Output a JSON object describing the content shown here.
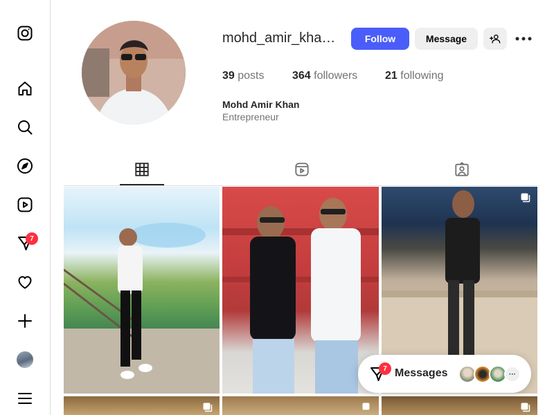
{
  "sidebar": {
    "items": [
      {
        "name": "instagram-logo-icon"
      },
      {
        "name": "home-icon"
      },
      {
        "name": "search-icon"
      },
      {
        "name": "explore-icon"
      },
      {
        "name": "reels-icon"
      },
      {
        "name": "messages-icon",
        "badge": "7"
      },
      {
        "name": "notifications-heart-icon"
      },
      {
        "name": "create-plus-icon"
      },
      {
        "name": "profile-avatar"
      },
      {
        "name": "more-menu-icon"
      }
    ]
  },
  "profile": {
    "username": "mohd_amir_khan...",
    "follow_label": "Follow",
    "message_label": "Message",
    "stats": {
      "posts_count": "39",
      "posts_label": "posts",
      "followers_count": "364",
      "followers_label": "followers",
      "following_count": "21",
      "following_label": "following"
    },
    "full_name": "Mohd Amir Khan",
    "bio": "Entrepreneur"
  },
  "tabs": [
    {
      "name": "posts-grid-icon",
      "active": true
    },
    {
      "name": "reels-tab-icon",
      "active": false
    },
    {
      "name": "tagged-icon",
      "active": false
    }
  ],
  "messages_widget": {
    "label": "Messages",
    "badge": "7",
    "more": "···"
  },
  "colors": {
    "accent": "#4a5df9",
    "badge": "#ff3040",
    "border": "#dbdbdb",
    "secondary_text": "#737373"
  }
}
